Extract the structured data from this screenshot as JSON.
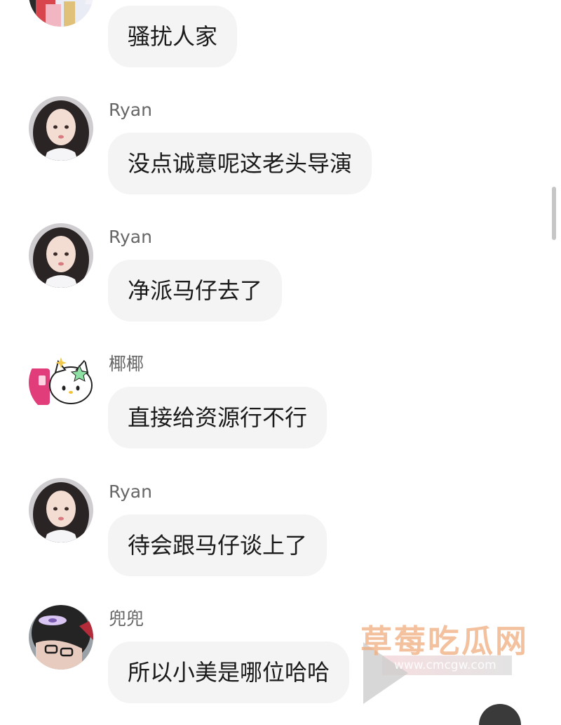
{
  "messages": [
    {
      "sender": "",
      "text": "骚扰人家",
      "avatar": "avatar-icon"
    },
    {
      "sender": "Ryan",
      "text": "没点诚意呢这老头导演",
      "avatar": "avatar-icon"
    },
    {
      "sender": "Ryan",
      "text": "净派马仔去了",
      "avatar": "avatar-icon"
    },
    {
      "sender": "椰椰",
      "text": "直接给资源行不行",
      "avatar": "hello-kitty-avatar-icon"
    },
    {
      "sender": "Ryan",
      "text": "待会跟马仔谈上了",
      "avatar": "avatar-icon"
    },
    {
      "sender": "兜兜",
      "text": "所以小美是哪位哈哈",
      "avatar": "avatar-icon"
    }
  ],
  "watermark": {
    "title": "草莓吃瓜网",
    "url": "www.cmcgw.com"
  },
  "colors": {
    "bubble": "#f4f4f4",
    "sender": "#666666",
    "text": "#1a1a1a",
    "watermark": "#efac7e"
  }
}
